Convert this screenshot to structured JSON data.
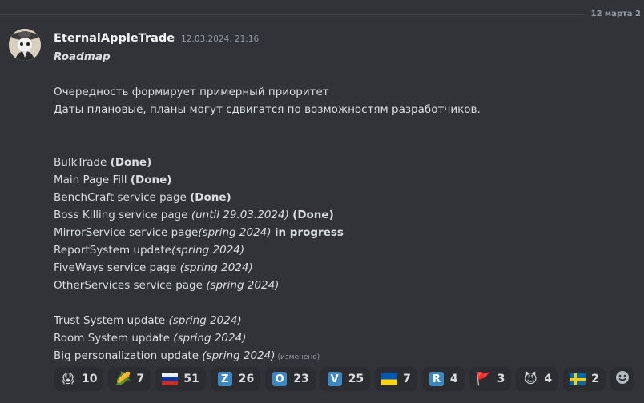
{
  "date_divider": "12 марта 2",
  "message": {
    "author": "EternalAppleTrade",
    "timestamp": "12.03.2024, 21:16",
    "title": "Roadmap",
    "intro_line1": "Очередность формирует примерный приоритет",
    "intro_line2": "Даты плановые, планы могут сдвигатся по возможностям разработчиков.",
    "items_group1": [
      {
        "name": "BulkTrade",
        "date": "",
        "status": "(Done)"
      },
      {
        "name": "Main Page Fill",
        "date": "",
        "status": "(Done)"
      },
      {
        "name": "BenchCraft service page",
        "date": "",
        "status": "(Done)"
      },
      {
        "name": "Boss Killing service page",
        "date": "(until 29.03.2024)",
        "status": "(Done)"
      },
      {
        "name": "MirrorService service page",
        "date": "(spring 2024)",
        "status": "in progress"
      },
      {
        "name": "ReportSystem update",
        "date": "(spring 2024)",
        "status": ""
      },
      {
        "name": "FiveWays service page",
        "date": "(spring 2024)",
        "status": ""
      },
      {
        "name": "OtherServices service page",
        "date": "(spring 2024)",
        "status": ""
      }
    ],
    "items_group2": [
      {
        "name": "Trust System update",
        "date": "(spring 2024)"
      },
      {
        "name": "Room System update",
        "date": "(spring 2024)"
      },
      {
        "name": "Big personalization update",
        "date": "(spring 2024)"
      }
    ],
    "edited_label": "(изменено)"
  },
  "reactions": [
    {
      "icon": "scream-emoji",
      "glyph": "😱",
      "count": "10"
    },
    {
      "icon": "corn-emoji",
      "glyph": "🌽",
      "count": "7"
    },
    {
      "icon": "russia-flag-emoji",
      "glyph": "",
      "count": "51"
    },
    {
      "icon": "letter-z-emoji",
      "glyph": "Z",
      "count": "26"
    },
    {
      "icon": "letter-o-emoji",
      "glyph": "O",
      "count": "23"
    },
    {
      "icon": "letter-v-emoji",
      "glyph": "V",
      "count": "25"
    },
    {
      "icon": "ukraine-flag-emoji",
      "glyph": "",
      "count": "7"
    },
    {
      "icon": "letter-r-emoji",
      "glyph": "R",
      "count": "4"
    },
    {
      "icon": "triangular-flag-emoji",
      "glyph": "🚩",
      "count": "3"
    },
    {
      "icon": "smiling-imp-emoji",
      "glyph": "😈",
      "count": "4"
    },
    {
      "icon": "sweden-flag-emoji",
      "glyph": "",
      "count": "2"
    }
  ],
  "colors": {
    "background": "#313338",
    "reaction_bg": "#2b2d31",
    "muted_text": "#949ba4"
  }
}
